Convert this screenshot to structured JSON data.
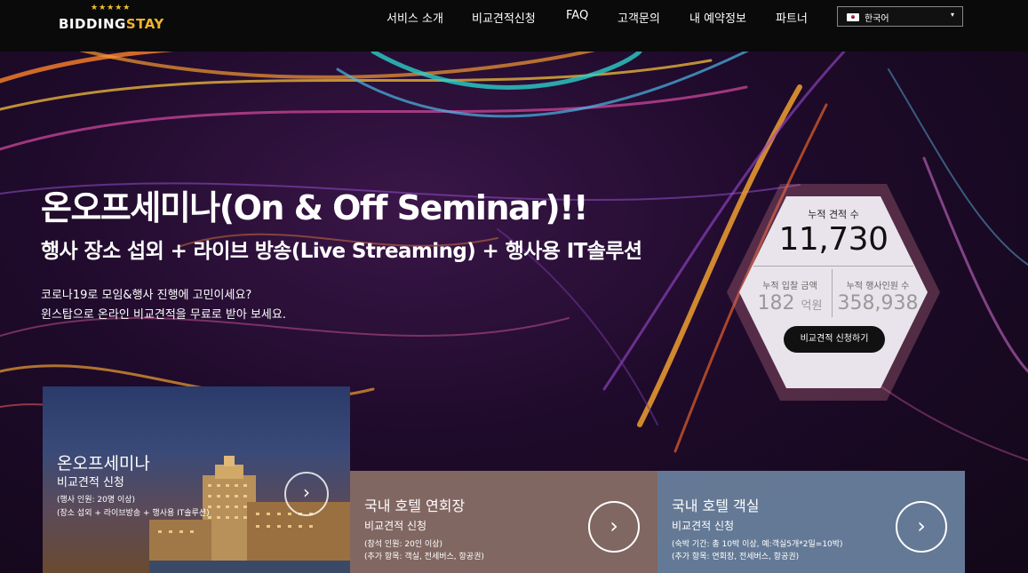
{
  "header": {
    "logo_text_main": "BIDDING",
    "logo_text_accent": "STAY",
    "logo_stars": "★★★★★",
    "nav": [
      "서비스 소개",
      "비교견적신청",
      "FAQ",
      "고객문의",
      "내 예약정보",
      "파트너"
    ],
    "language": {
      "selected": "한국어",
      "arrow": "▾"
    }
  },
  "hero": {
    "title": "온오프세미나(On & Off Seminar)!!",
    "subtitle": "행사 장소 섭외 + 라이브 방송(Live Streaming) + 행사용 IT솔루션",
    "desc_line1": "코로나19로 모임&행사 진행에 고민이세요?",
    "desc_line2": "윈스탑으로 온라인 비교견적을 무료로 받아 보세요."
  },
  "stats": {
    "total_label": "누적 견적 수",
    "total_value": "11,730",
    "bid_label": "누적 입찰 금액",
    "bid_value": "182",
    "bid_unit": "억원",
    "people_label": "누적 행사인원 수",
    "people_value": "358,938",
    "button_label": "비교견적 신청하기"
  },
  "cards": [
    {
      "title": "온오프세미나",
      "sub": "비교견적 신청",
      "note1": "(행사 인원: 20명 이상)",
      "note2": "(장소 섭외 + 라이브방송 + 행사용 IT솔루션)",
      "arrow": "›"
    },
    {
      "title": "국내 호텔 연회장",
      "sub": "비교견적 신청",
      "note1": "(참석 인원: 20인 이상)",
      "note2": "(추가 항목: 객실, 전세버스, 항공권)",
      "arrow": "›"
    },
    {
      "title": "국내 호텔 객실",
      "sub": "비교견적 신청",
      "note1": "(숙박 기간: 총 10박 이상, 예:객실5개*2일=10박)",
      "note2": "(추가 항목: 연회장, 전세버스, 항공권)",
      "arrow": "›"
    }
  ],
  "colors": {
    "accent_gold": "#f0b429",
    "card_banquet": "#8a7067",
    "card_room": "#6b83a0",
    "stats_bg": "#e9e4ec"
  }
}
